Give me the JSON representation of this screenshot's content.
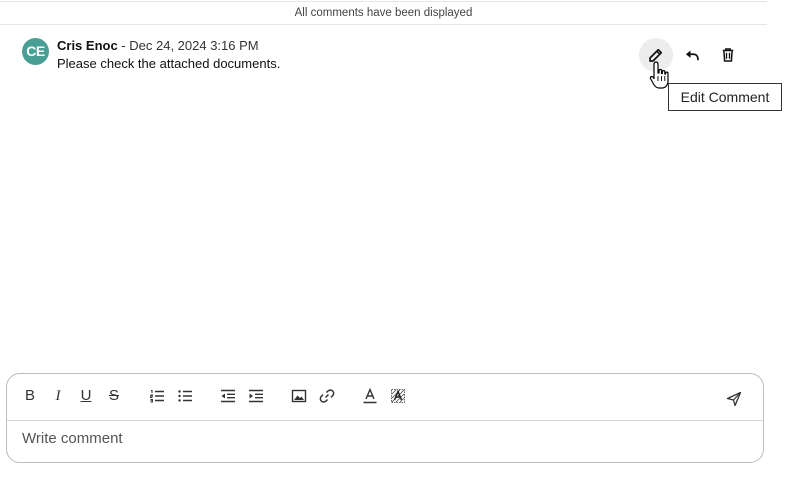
{
  "banner": {
    "text": "All comments have been displayed"
  },
  "comment": {
    "avatar_initials": "CE",
    "avatar_color": "#4a9f95",
    "author": "Cris Enoc",
    "separator": " - ",
    "date": "Dec 24, 2024 3:16 PM",
    "text": "Please check the attached documents."
  },
  "actions": {
    "edit_icon": "pencil-icon",
    "reply_icon": "reply-icon",
    "delete_icon": "trash-icon"
  },
  "tooltip": {
    "text": "Edit Comment"
  },
  "editor": {
    "toolbar": {
      "bold": "B",
      "italic": "I",
      "underline": "U",
      "strike": "S",
      "icons": [
        "bold-icon",
        "italic-icon",
        "underline-icon",
        "strikethrough-icon",
        "ordered-list-icon",
        "bullet-list-icon",
        "outdent-icon",
        "indent-icon",
        "image-icon",
        "link-icon",
        "font-color-icon",
        "clear-format-icon",
        "send-icon"
      ]
    },
    "placeholder": "Write comment"
  }
}
